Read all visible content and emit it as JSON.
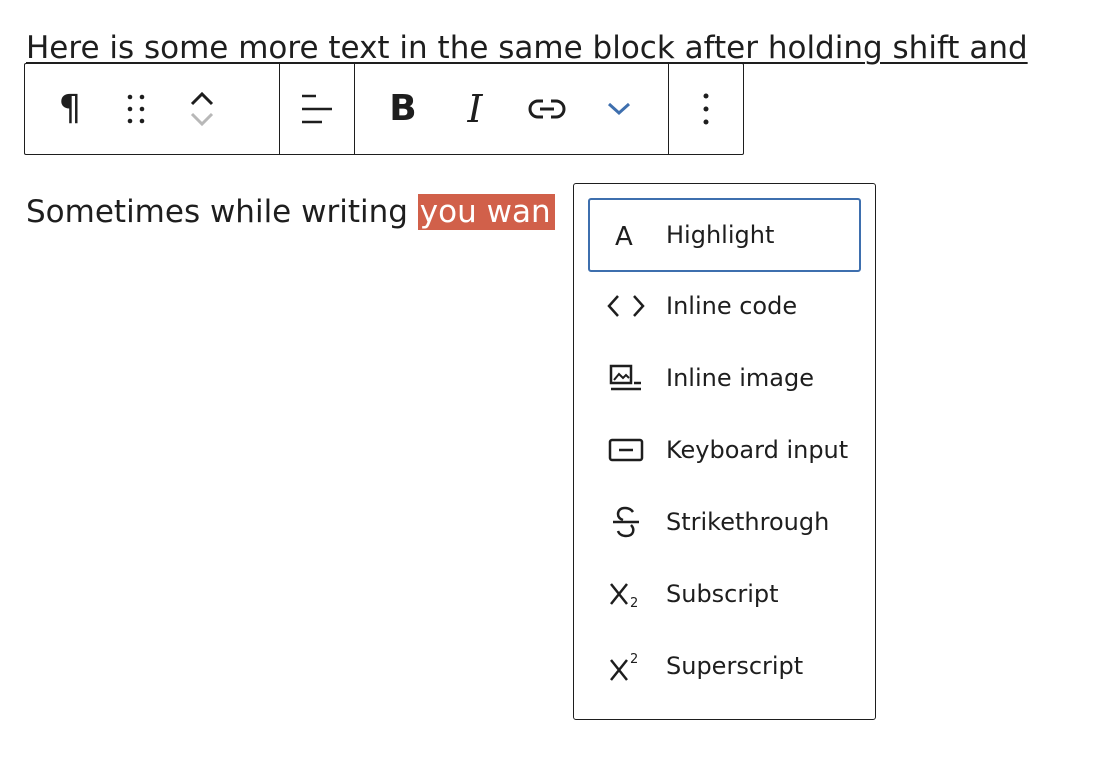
{
  "editor": {
    "line1": "Here is some more text in the same block after holding shift and",
    "line2_before": "Sometimes while writing ",
    "line2_selected": "you wan"
  },
  "toolbar": {
    "paragraph_glyph": "¶",
    "bold_label": "B",
    "italic_label": "I",
    "icons": [
      "paragraph-icon",
      "drag-handle-icon",
      "move-up-icon",
      "move-down-icon",
      "align-left-icon",
      "bold-icon",
      "italic-icon",
      "link-icon",
      "chevron-down-icon",
      "more-options-icon"
    ]
  },
  "format_menu": {
    "items": [
      {
        "label": "Highlight",
        "icon": "highlight-icon",
        "focused": true
      },
      {
        "label": "Inline code",
        "icon": "code-icon"
      },
      {
        "label": "Inline image",
        "icon": "image-icon"
      },
      {
        "label": "Keyboard input",
        "icon": "keyboard-icon"
      },
      {
        "label": "Strikethrough",
        "icon": "strikethrough-icon"
      },
      {
        "label": "Subscript",
        "icon": "subscript-icon"
      },
      {
        "label": "Superscript",
        "icon": "superscript-icon"
      }
    ]
  },
  "colors": {
    "selection": "#d1604a",
    "focus_ring": "#3e6fae",
    "chevron_accent": "#3e6fae",
    "text": "#1e1e1e"
  }
}
